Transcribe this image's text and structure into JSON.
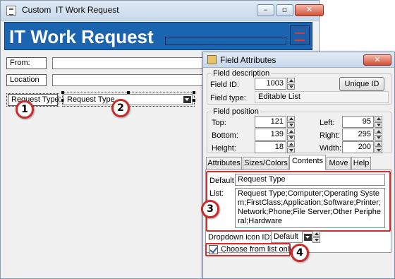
{
  "back_window": {
    "title": "Custom  IT Work Request",
    "banner_title": "IT Work Request",
    "from_label": "From:",
    "location_label": "Location",
    "request_type_label": "Request Type:",
    "request_type_value": "Request Type",
    "colors": {
      "banner": "#1a64b0",
      "annotation": "#cc2b2b"
    }
  },
  "dialog": {
    "title": "Field Attributes",
    "close_label": "✕",
    "field_description": {
      "group_title": "Field description",
      "field_id_label": "Field ID:",
      "field_id_value": "1003",
      "unique_id_button": "Unique ID",
      "field_type_label": "Field type:",
      "field_type_value": "Editable List"
    },
    "field_position": {
      "group_title": "Field position",
      "top_label": "Top:",
      "top_value": "121",
      "left_label": "Left:",
      "left_value": "95",
      "bottom_label": "Bottom:",
      "bottom_value": "139",
      "right_label": "Right:",
      "right_value": "295",
      "height_label": "Height:",
      "height_value": "18",
      "width_label": "Width:",
      "width_value": "200"
    },
    "tabs": [
      "Attributes",
      "Sizes/Colors",
      "Contents",
      "Move",
      "Help"
    ],
    "active_tab": "Contents",
    "contents": {
      "default_label": "Default:",
      "default_value": "Request Type",
      "list_label": "List:",
      "list_value": "Request Type;Computer;Operating System;FirstClass;Application;Software;Printer;Network;Phone;File Server;Other Peripheral;Hardware",
      "dropdown_icon_label": "Dropdown icon ID:",
      "dropdown_icon_value": "Default",
      "choose_from_list_label": "Choose from list only",
      "choose_from_list_checked": true
    }
  },
  "annotations": [
    "1",
    "2",
    "3",
    "4"
  ]
}
